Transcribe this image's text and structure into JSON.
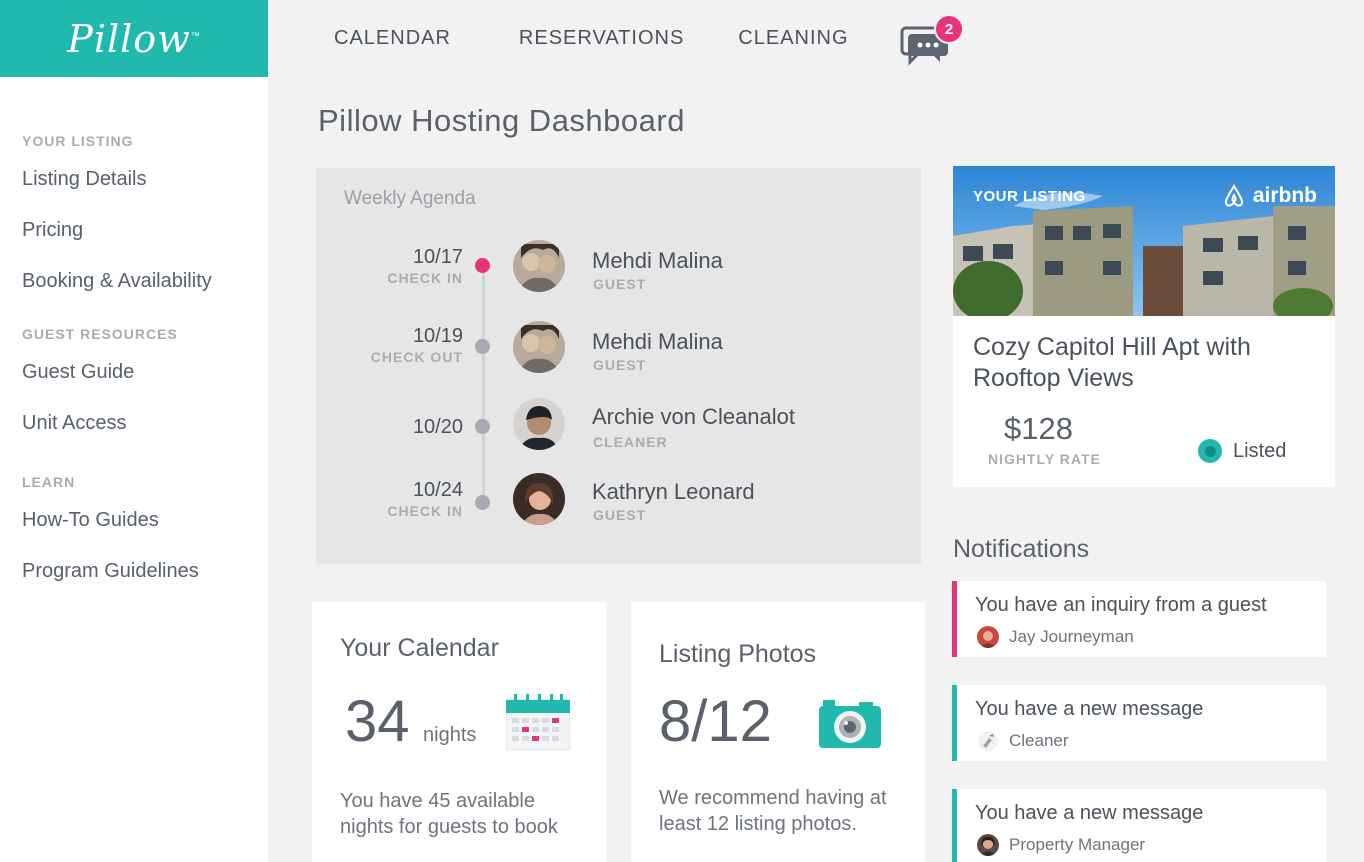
{
  "brand": {
    "logo": "Pillow",
    "tm": "™"
  },
  "sidebar": {
    "sections": [
      {
        "heading": "YOUR LISTING",
        "items": [
          "Listing Details",
          "Pricing",
          "Booking & Availability"
        ]
      },
      {
        "heading": "GUEST RESOURCES",
        "items": [
          "Guest Guide",
          "Unit Access"
        ]
      },
      {
        "heading": "LEARN",
        "items": [
          "How-To Guides",
          "Program Guidelines"
        ]
      }
    ]
  },
  "nav": {
    "calendar": "CALENDAR",
    "reservations": "RESERVATIONS",
    "cleaning": "CLEANING",
    "messages_count": "2"
  },
  "page": {
    "title": "Pillow Hosting Dashboard"
  },
  "agenda": {
    "title": "Weekly Agenda",
    "items": [
      {
        "date": "10/17",
        "event": "CHECK IN",
        "name": "Mehdi Malina",
        "role": "GUEST",
        "active": true
      },
      {
        "date": "10/19",
        "event": "CHECK OUT",
        "name": "Mehdi Malina",
        "role": "GUEST",
        "active": false
      },
      {
        "date": "10/20",
        "event": "",
        "name": "Archie von Cleanalot",
        "role": "CLEANER",
        "active": false
      },
      {
        "date": "10/24",
        "event": "CHECK IN",
        "name": "Kathryn Leonard",
        "role": "GUEST",
        "active": false
      }
    ]
  },
  "calendar_card": {
    "title": "Your Calendar",
    "value": "34",
    "unit": "nights",
    "description": "You have 45 available nights for guests to book"
  },
  "photos_card": {
    "title": "Listing Photos",
    "value": "8/12",
    "description": "We recommend having at least 12 listing photos."
  },
  "listing": {
    "label": "YOUR LISTING",
    "provider": "airbnb",
    "title": "Cozy Capitol Hill Apt with Rooftop Views",
    "price": "$128",
    "price_label": "NIGHTLY RATE",
    "status": "Listed"
  },
  "notifications": {
    "heading": "Notifications",
    "items": [
      {
        "text": "You have an inquiry from a guest",
        "from": "Jay Journeyman",
        "color": "#e8337a"
      },
      {
        "text": "You have a new message",
        "from": "Cleaner",
        "color": "#21b9ad"
      },
      {
        "text": "You have a new message",
        "from": "Property Manager",
        "color": "#21b9ad"
      }
    ]
  },
  "colors": {
    "teal": "#21b9ad",
    "pink": "#e8337a"
  }
}
